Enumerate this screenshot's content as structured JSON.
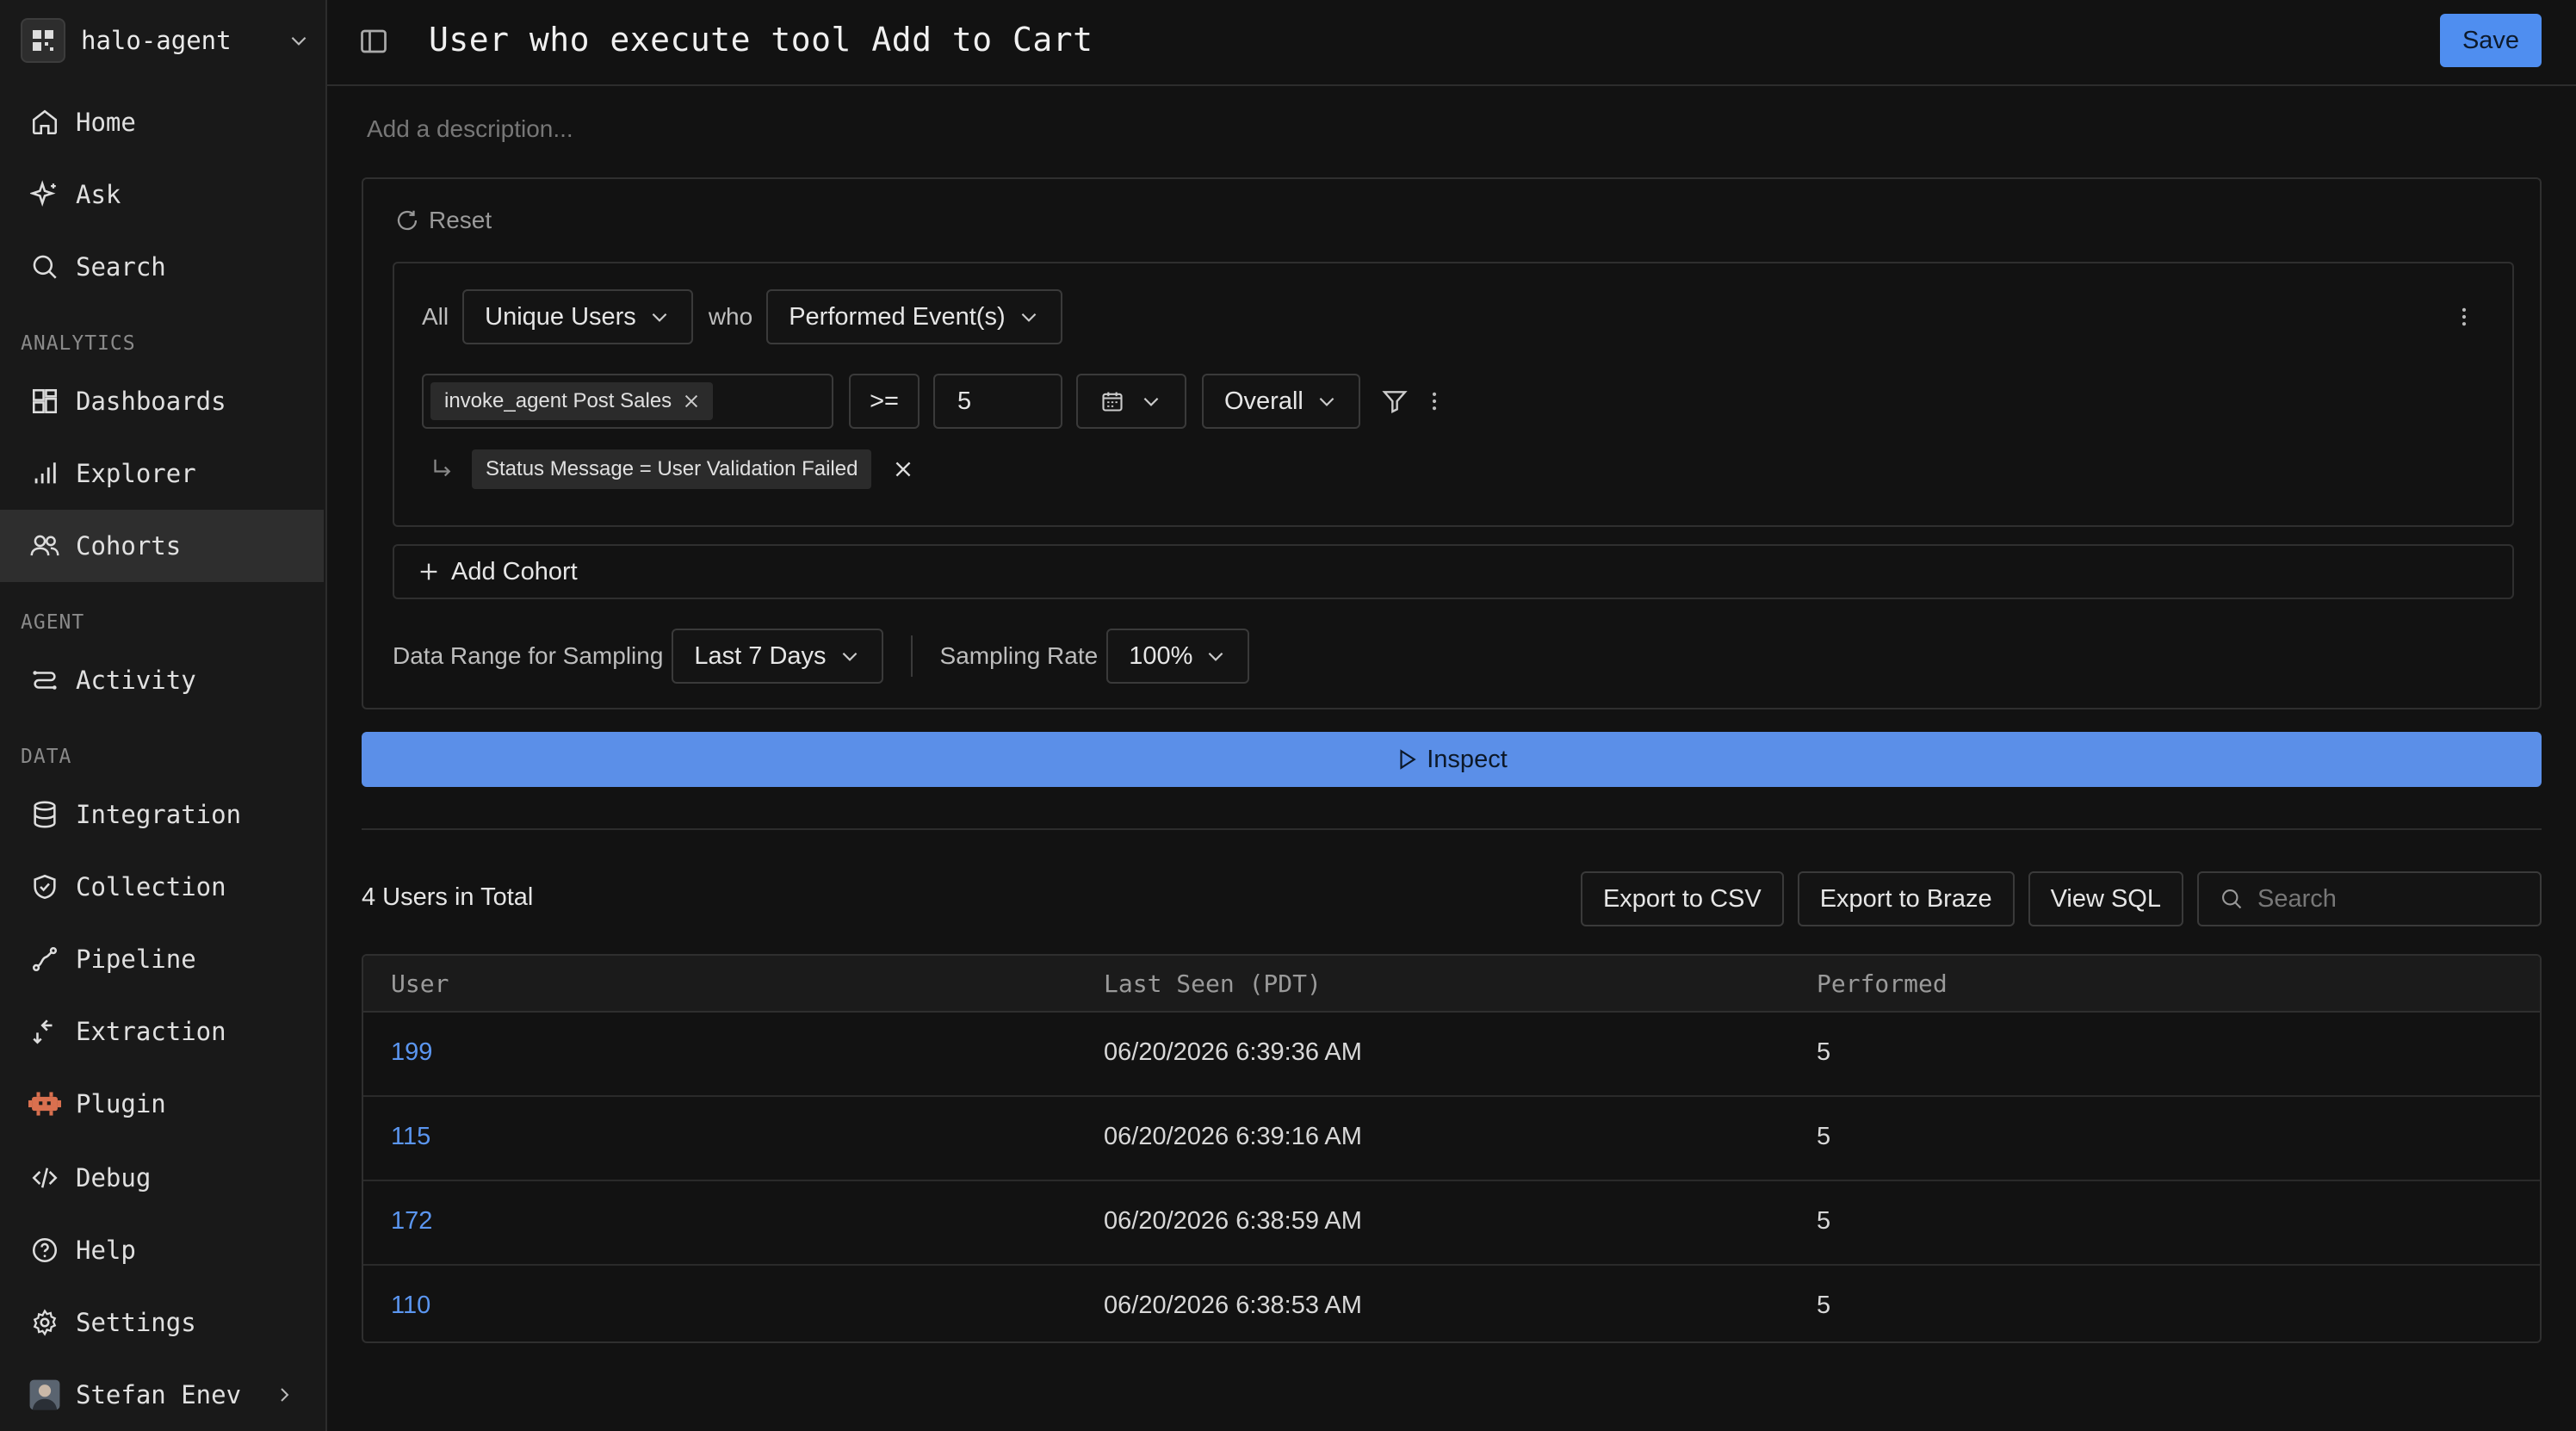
{
  "workspace": {
    "name": "halo-agent"
  },
  "sidebar": {
    "items_top": [
      {
        "label": "Home",
        "icon": "home-icon"
      },
      {
        "label": "Ask",
        "icon": "sparkle-icon"
      },
      {
        "label": "Search",
        "icon": "search-icon"
      }
    ],
    "analytics_label": "ANALYTICS",
    "analytics": [
      {
        "label": "Dashboards",
        "icon": "dashboard-icon"
      },
      {
        "label": "Explorer",
        "icon": "bar-chart-icon"
      },
      {
        "label": "Cohorts",
        "icon": "users-icon",
        "active": true
      }
    ],
    "agent_label": "AGENT",
    "agent": [
      {
        "label": "Activity",
        "icon": "activity-icon"
      }
    ],
    "data_label": "DATA",
    "data": [
      {
        "label": "Integration",
        "icon": "database-icon"
      },
      {
        "label": "Collection",
        "icon": "shield-check-icon"
      },
      {
        "label": "Pipeline",
        "icon": "pipeline-icon"
      },
      {
        "label": "Extraction",
        "icon": "extraction-icon"
      },
      {
        "label": "Plugin",
        "icon": "plugin-icon"
      },
      {
        "label": "Debug",
        "icon": "code-icon"
      },
      {
        "label": "Help",
        "icon": "help-icon"
      },
      {
        "label": "Settings",
        "icon": "gear-icon"
      }
    ],
    "user": {
      "name": "Stefan Enev"
    }
  },
  "header": {
    "title": "User who execute tool Add to Cart",
    "save_label": "Save"
  },
  "description_placeholder": "Add a description...",
  "builder": {
    "reset_label": "Reset",
    "all_label": "All",
    "entity": "Unique Users",
    "who_label": "who",
    "condition": "Performed Event(s)",
    "event_chip": "invoke_agent Post Sales",
    "operator": ">=",
    "count_value": "5",
    "aggregation": "Overall",
    "filter_chip": "Status Message = User Validation Failed",
    "add_cohort_label": "Add Cohort",
    "sampling_range_label": "Data Range for Sampling",
    "sampling_range_value": "Last 7 Days",
    "sampling_rate_label": "Sampling Rate",
    "sampling_rate_value": "100%"
  },
  "inspect_label": "Inspect",
  "results": {
    "total_label": "4 Users in Total",
    "export_csv": "Export to CSV",
    "export_braze": "Export to Braze",
    "view_sql": "View SQL",
    "search_placeholder": "Search",
    "columns": [
      "User",
      "Last Seen (PDT)",
      "Performed"
    ],
    "rows": [
      {
        "user": "199",
        "last_seen": "06/20/2026 6:39:36 AM",
        "performed": "5"
      },
      {
        "user": "115",
        "last_seen": "06/20/2026 6:39:16 AM",
        "performed": "5"
      },
      {
        "user": "172",
        "last_seen": "06/20/2026 6:38:59 AM",
        "performed": "5"
      },
      {
        "user": "110",
        "last_seen": "06/20/2026 6:38:53 AM",
        "performed": "5"
      }
    ]
  },
  "colors": {
    "accent": "#4f8ef0",
    "link": "#5b96f0",
    "background": "#121212",
    "sidebar": "#191919"
  }
}
